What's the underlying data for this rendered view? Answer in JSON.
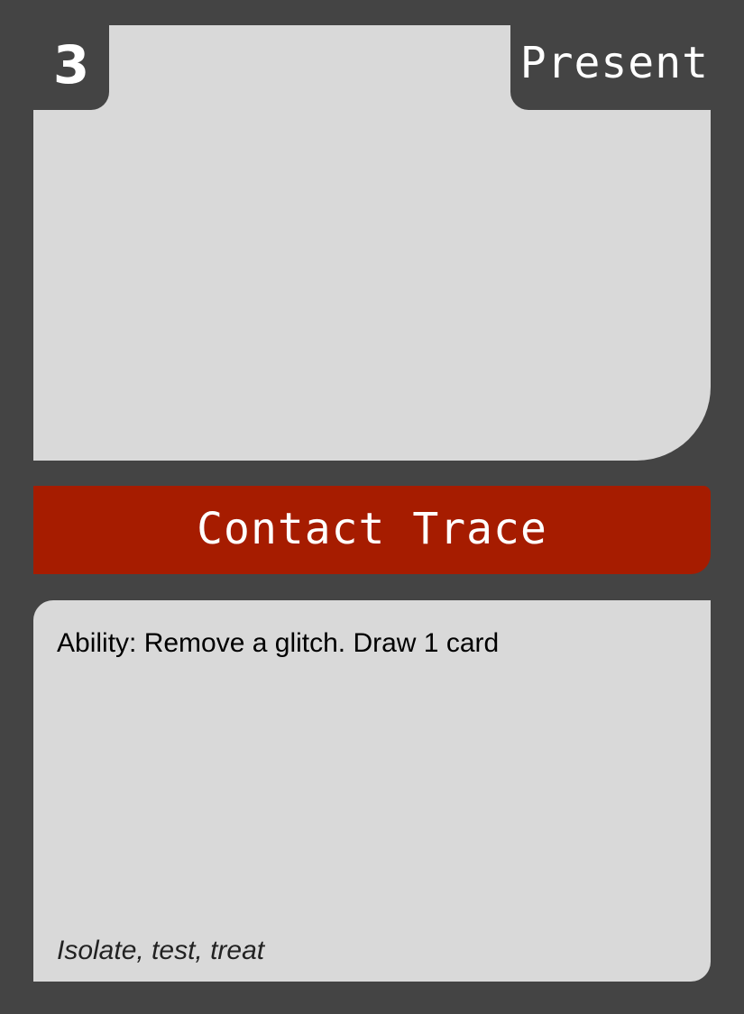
{
  "card": {
    "cost": "3",
    "era": "Present",
    "title": "Contact Trace",
    "ability": "Ability: Remove a glitch. Draw 1 card",
    "flavor": "Isolate, test, treat"
  },
  "colors": {
    "frame": "#444444",
    "panel": "#d9d9d9",
    "title_bar": "#a61c00",
    "text_light": "#ffffff",
    "text_dark": "#000000"
  }
}
